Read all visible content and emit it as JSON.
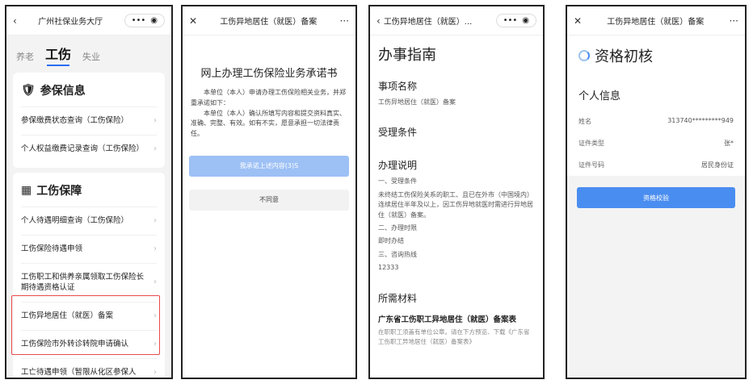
{
  "screen1": {
    "nav_title": "广州社保业务大厅",
    "capsule_dots": "•••",
    "tabs": [
      "养老",
      "工伤",
      "失业"
    ],
    "section1": {
      "title": "参保信息",
      "items": [
        "参保缴费状态查询（工伤保险）",
        "个人权益缴费记录查询（工伤保险）"
      ]
    },
    "section2": {
      "title": "工伤保障",
      "items": [
        "个人待遇明细查询（工伤保险）",
        "工伤保险待遇申领",
        "工伤职工和供养亲属领取工伤保险长期待遇资格认证",
        "工伤异地居住（就医）备案",
        "工伤保险市外转诊转院申请确认",
        "工亡待遇申领（暂限从化区参保人"
      ]
    }
  },
  "screen2": {
    "nav_title": "工伤异地居住（就医）备案",
    "more": "···",
    "title": "网上办理工伤保险业务承诺书",
    "p1": "本单位（本人）申请办理工伤保险相关业务，并郑重承诺如下：",
    "p2": "本单位（本人）确认所填写内容和提交资料真实、准确、完整、有效。如有不实，愿意承担一切法律责任。",
    "agree": "我承诺上述内容(3)S",
    "disagree": "不同意"
  },
  "screen3": {
    "nav_title": "工伤异地居住（就医）...",
    "h1": "办事指南",
    "item_name_h": "事项名称",
    "item_name": "工伤异地居住（就医）备案",
    "accept_h": "受理条件",
    "desc_h": "办理说明",
    "desc1_title": "一、受理条件",
    "desc1": "未终结工伤保险关系的职工、且已在外市（中国境内）连续居住半年及以上，因工伤异地就医时需进行异地居住（就医）备案。",
    "desc2_title": "二、办理时限",
    "desc2": "即时办结",
    "desc3_title": "三、咨询热线",
    "desc3": "12333",
    "materials_h": "所需材料",
    "material_name": "广东省工伤职工异地居住（就医）备案表",
    "material_note": "在职职工须盖有单位公章。请在下方预览、下载《广东省工伤职工异地居住（就医）备案表》"
  },
  "screen4": {
    "nav_title": "工伤异地居住（就医）备案",
    "more": "···",
    "title": "资格初核",
    "section": "个人信息",
    "rows": [
      {
        "label": "姓名",
        "value": "313740*********949"
      },
      {
        "label": "证件类型",
        "value": "张*"
      },
      {
        "label": "证件号码",
        "value": "居民身份证"
      }
    ],
    "button": "资格校验"
  }
}
